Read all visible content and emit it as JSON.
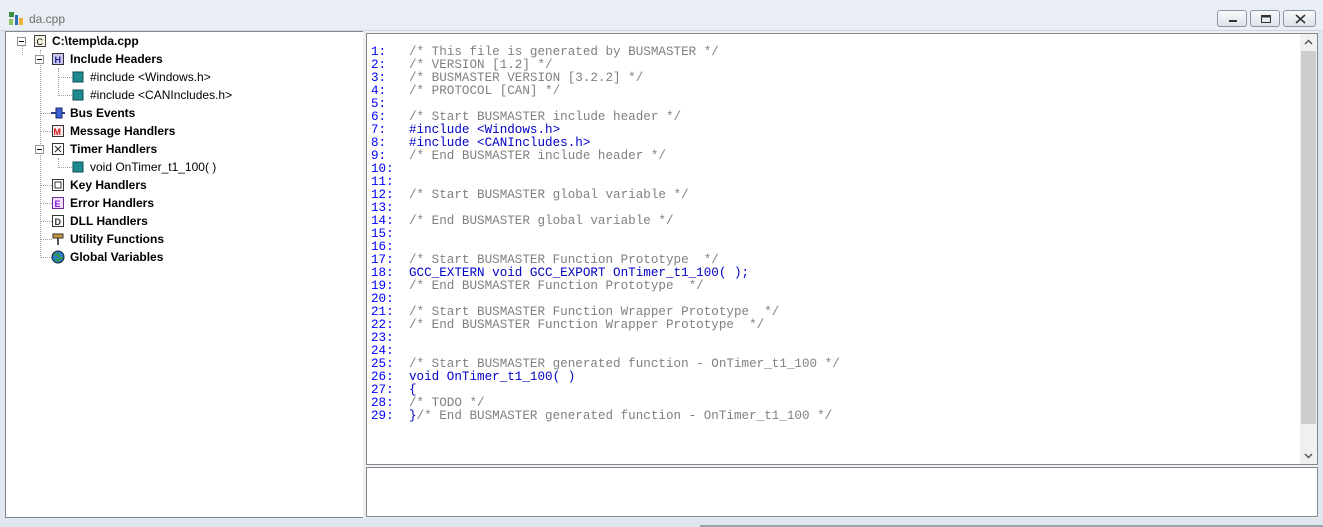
{
  "window": {
    "title": "da.cpp",
    "icon": "app-icon",
    "buttons": [
      "minimize",
      "maximize",
      "close"
    ]
  },
  "tree": {
    "root": "C:\\temp\\da.cpp",
    "include_headers": "Include Headers",
    "include_1": "#include <Windows.h>",
    "include_2": "#include <CANIncludes.h>",
    "bus_events": "Bus Events",
    "message_handlers": "Message Handlers",
    "timer_handlers": "Timer Handlers",
    "timer_1": "void OnTimer_t1_100( )",
    "key_handlers": "Key Handlers",
    "error_handlers": "Error Handlers",
    "dll_handlers": "DLL Handlers",
    "utility_functions": "Utility Functions",
    "global_variables": "Global Variables"
  },
  "code": {
    "lines": [
      {
        "n": "1:",
        "t": "/* This file is generated by BUSMASTER */",
        "k": "comment"
      },
      {
        "n": "2:",
        "t": "/* VERSION [1.2] */",
        "k": "comment"
      },
      {
        "n": "3:",
        "t": "/* BUSMASTER VERSION [3.2.2] */",
        "k": "comment"
      },
      {
        "n": "4:",
        "t": "/* PROTOCOL [CAN] */",
        "k": "comment"
      },
      {
        "n": "5:",
        "t": "",
        "k": "comment"
      },
      {
        "n": "6:",
        "t": "/* Start BUSMASTER include header */",
        "k": "comment"
      },
      {
        "n": "7:",
        "t": "#include <Windows.h>",
        "k": "code"
      },
      {
        "n": "8:",
        "t": "#include <CANIncludes.h>",
        "k": "code"
      },
      {
        "n": "9:",
        "t": "/* End BUSMASTER include header */",
        "k": "comment"
      },
      {
        "n": "10:",
        "t": "",
        "k": "comment"
      },
      {
        "n": "11:",
        "t": "",
        "k": "comment"
      },
      {
        "n": "12:",
        "t": "/* Start BUSMASTER global variable */",
        "k": "comment"
      },
      {
        "n": "13:",
        "t": "",
        "k": "comment"
      },
      {
        "n": "14:",
        "t": "/* End BUSMASTER global variable */",
        "k": "comment"
      },
      {
        "n": "15:",
        "t": "",
        "k": "comment"
      },
      {
        "n": "16:",
        "t": "",
        "k": "comment"
      },
      {
        "n": "17:",
        "t": "/* Start BUSMASTER Function Prototype  */",
        "k": "comment"
      },
      {
        "n": "18:",
        "t": "GCC_EXTERN void GCC_EXPORT OnTimer_t1_100( );",
        "k": "code"
      },
      {
        "n": "19:",
        "t": "/* End BUSMASTER Function Prototype  */",
        "k": "comment"
      },
      {
        "n": "20:",
        "t": "",
        "k": "comment"
      },
      {
        "n": "21:",
        "t": "/* Start BUSMASTER Function Wrapper Prototype  */",
        "k": "comment"
      },
      {
        "n": "22:",
        "t": "/* End BUSMASTER Function Wrapper Prototype  */",
        "k": "comment"
      },
      {
        "n": "23:",
        "t": "",
        "k": "comment"
      },
      {
        "n": "24:",
        "t": "",
        "k": "comment"
      },
      {
        "n": "25:",
        "t": "/* Start BUSMASTER generated function - OnTimer_t1_100 */",
        "k": "comment"
      },
      {
        "n": "26:",
        "t": "void OnTimer_t1_100( )",
        "k": "code"
      },
      {
        "n": "27:",
        "t": "{",
        "k": "code"
      },
      {
        "n": "28:",
        "t": "/* TODO */",
        "k": "comment"
      },
      {
        "n": "29:",
        "t": "}/* End BUSMASTER generated function - OnTimer_t1_100 */",
        "k": "mixed"
      }
    ]
  },
  "colors": {
    "line_number": "#0000ff",
    "comment": "#808080",
    "code": "#0000c8"
  }
}
